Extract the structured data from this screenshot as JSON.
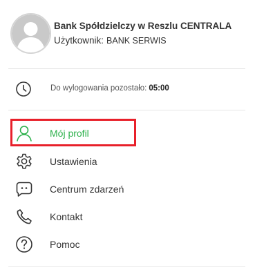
{
  "user": {
    "bank_name": "Bank Spółdzielczy w Reszlu CENTRALA",
    "user_label": "Użytkownik:",
    "user_value": "BANK SERWIS"
  },
  "session": {
    "label": "Do wylogowania pozostało:",
    "time": "05:00"
  },
  "menu": {
    "items": [
      {
        "label": "Mój profil",
        "icon": "user-icon",
        "active": true
      },
      {
        "label": "Ustawienia",
        "icon": "gear-icon",
        "active": false
      },
      {
        "label": "Centrum zdarzeń",
        "icon": "message-icon",
        "active": false
      },
      {
        "label": "Kontakt",
        "icon": "phone-icon",
        "active": false
      },
      {
        "label": "Pomoc",
        "icon": "help-icon",
        "active": false
      }
    ]
  },
  "colors": {
    "accent": "#2bb04a",
    "highlight": "#e8202a",
    "text": "#333333",
    "divider": "#e6e6e6"
  }
}
